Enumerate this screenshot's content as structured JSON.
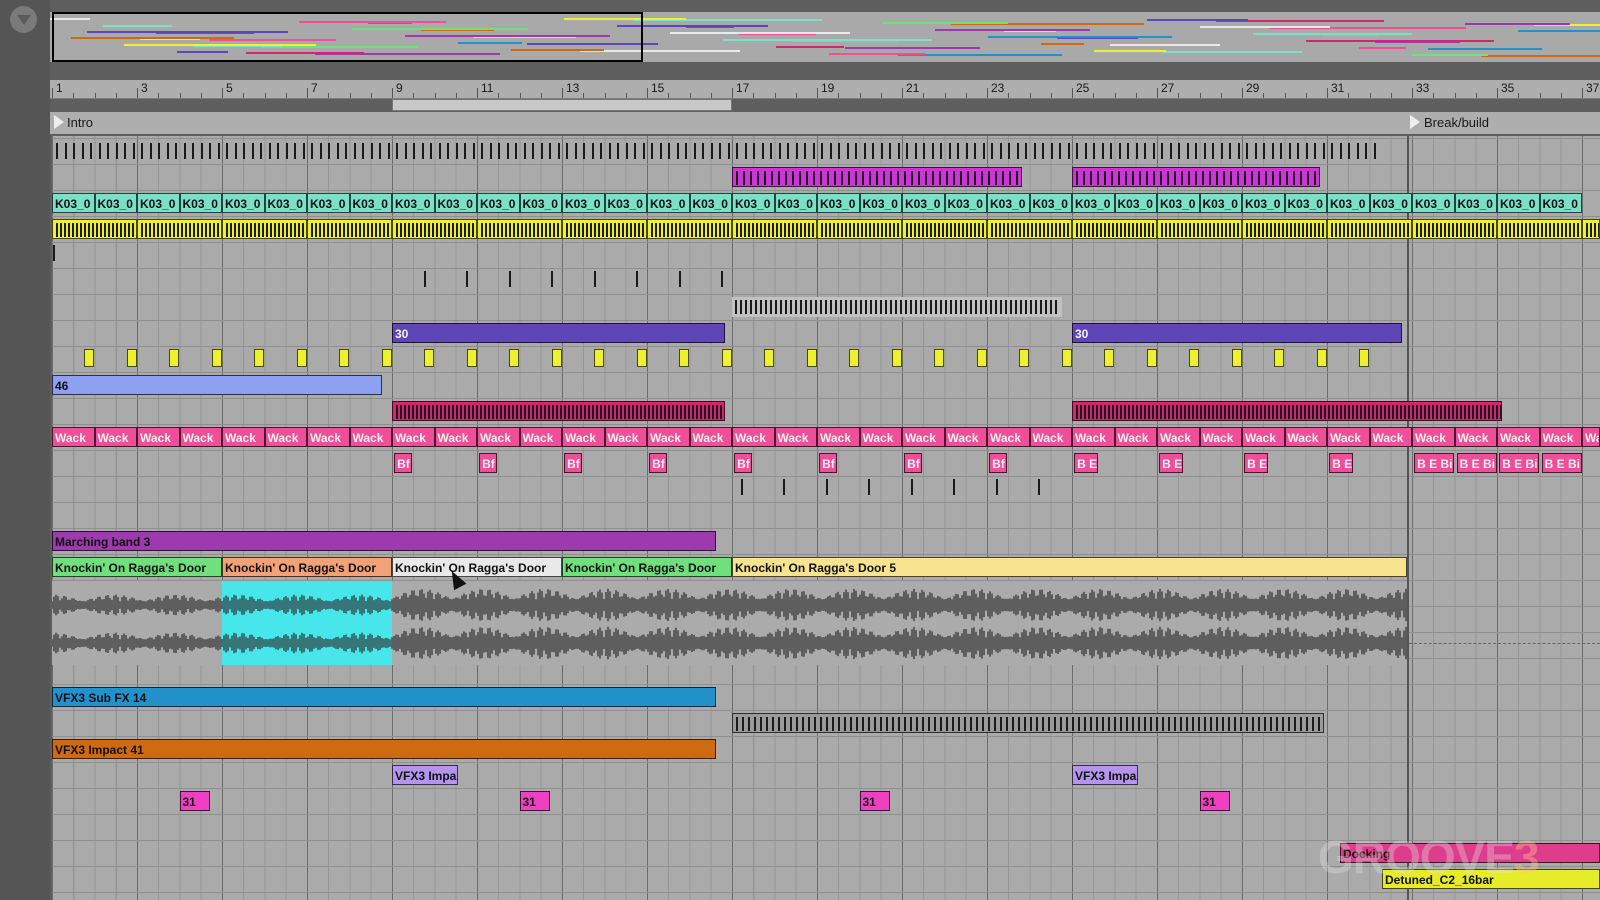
{
  "ruler": {
    "bars": [
      "1",
      "3",
      "5",
      "7",
      "9",
      "11",
      "13",
      "15",
      "17",
      "19",
      "21",
      "23",
      "25",
      "27",
      "29",
      "31",
      "33",
      "35",
      "37"
    ]
  },
  "locators": {
    "intro": "Intro",
    "break_build": "Break/build"
  },
  "clips": {
    "k03": "K03_0",
    "clip_30": "30",
    "clip_46": "46",
    "wacky": "Wack",
    "bf": "Bf",
    "be": "B E",
    "bebi": "B E Bi",
    "marching": "Marching band 3",
    "knock_door": "Knockin' On Ragga's Door",
    "knock_door5": "Knockin' On Ragga's Door 5",
    "subfx": "VFX3 Sub FX 14",
    "impact": "VFX3 Impact 41",
    "impa": "VFX3 Impa",
    "clip_31": "31",
    "docking": "Docking",
    "detuned": "Detuned_C2_16bar"
  },
  "colors": {
    "cyan": "#7be0c8",
    "yellow": "#eef22e",
    "purple": "#5e45b8",
    "magenta": "#cf34d6",
    "lilac": "#8ea1f0",
    "pink": "#ee4f98",
    "crimson": "#d0276e",
    "violet": "#9c3aae",
    "green": "#6fe07c",
    "salmon": "#f3a277",
    "white": "#e9e9e9",
    "yellowpale": "#f6e490",
    "blue": "#2391cc",
    "orange": "#cf6a10",
    "lav": "#b594ee",
    "hotpink": "#ef3fc2",
    "docking": "#dd3d8b",
    "detuned": "#e6eb2a"
  },
  "watermark": {
    "a": "GROOVE",
    "b": "3"
  }
}
